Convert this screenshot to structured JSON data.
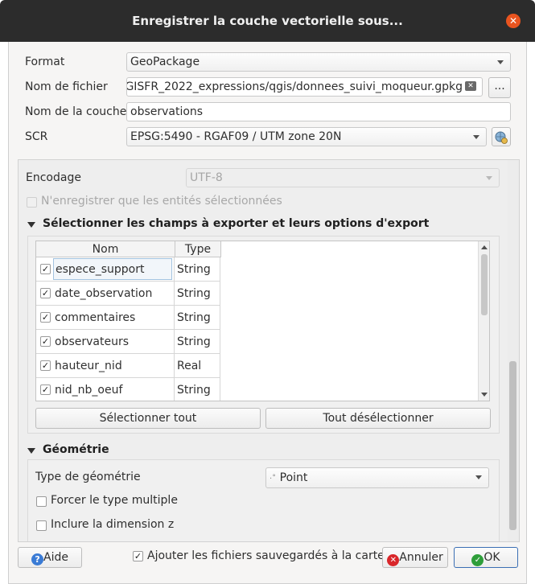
{
  "window": {
    "title": "Enregistrer la couche vectorielle sous..."
  },
  "format": {
    "label": "Format",
    "value": "GeoPackage"
  },
  "filename": {
    "label": "Nom de fichier",
    "value": "GISFR_2022_expressions/qgis/donnees_suivi_moqueur.gpkg",
    "browse_label": "..."
  },
  "layername": {
    "label": "Nom de la couche",
    "value": "observations"
  },
  "crs": {
    "label": "SCR",
    "value": "EPSG:5490 - RGAF09 / UTM zone 20N"
  },
  "encoding": {
    "label": "Encodage",
    "value": "UTF-8"
  },
  "selected_only": {
    "label": "N'enregistrer que les entités sélectionnées",
    "checked": false
  },
  "fields_section": {
    "title": "Sélectionner les champs à exporter et leurs options d'export",
    "col_name": "Nom",
    "col_type": "Type",
    "rows": [
      {
        "name": "espece_support",
        "type": "String",
        "checked": true
      },
      {
        "name": "date_observation",
        "type": "String",
        "checked": true
      },
      {
        "name": "commentaires",
        "type": "String",
        "checked": true
      },
      {
        "name": "observateurs",
        "type": "String",
        "checked": true
      },
      {
        "name": "hauteur_nid",
        "type": "Real",
        "checked": true
      },
      {
        "name": "nid_nb_oeuf",
        "type": "String",
        "checked": true
      }
    ],
    "select_all": "Sélectionner tout",
    "deselect_all": "Tout désélectionner"
  },
  "geometry_section": {
    "title": "Géométrie",
    "type_label": "Type de géométrie",
    "type_value": "Point",
    "force_multi": "Forcer le type multiple",
    "include_z": "Inclure la dimension z"
  },
  "footer": {
    "help": "Aide",
    "add_to_map": "Ajouter les fichiers sauvegardés à la carte",
    "add_to_map_checked": true,
    "cancel": "Annuler",
    "ok": "OK"
  },
  "colors": {
    "titlebar": "#2c2c2c",
    "close": "#e9541f",
    "help_icon": "#3a7bd5",
    "cancel_icon": "#d9262a",
    "ok_icon": "#2e9e3a"
  }
}
